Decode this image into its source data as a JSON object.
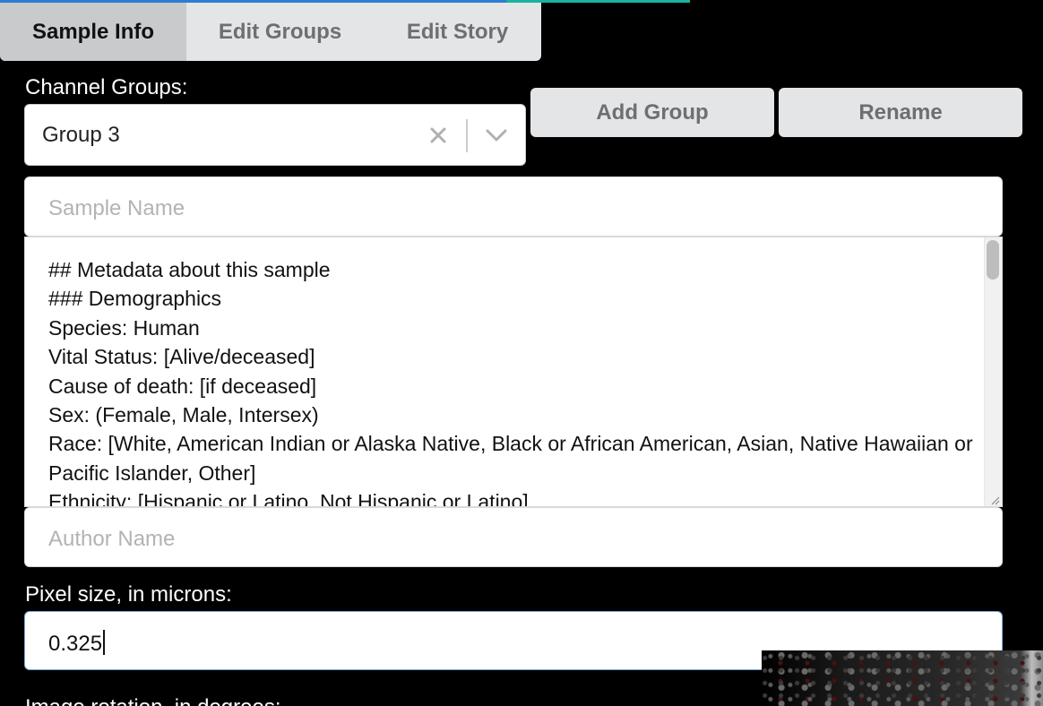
{
  "tabs": [
    {
      "label": "Sample Info",
      "active": true
    },
    {
      "label": "Edit Groups",
      "active": false
    },
    {
      "label": "Edit Story",
      "active": false
    }
  ],
  "channel_groups": {
    "label": "Channel Groups:",
    "selected": "Group 3",
    "clear_icon": "close-icon",
    "dropdown_icon": "chevron-down-icon"
  },
  "buttons": {
    "add_group": "Add Group",
    "rename": "Rename"
  },
  "sample_name": {
    "placeholder": "Sample Name",
    "value": ""
  },
  "description": {
    "lines": [
      "## Metadata about this sample",
      "### Demographics",
      "Species: Human",
      "Vital Status: [Alive/deceased]",
      "Cause of death: [if deceased]",
      "Sex: (Female, Male, Intersex)",
      "Race: [White, American Indian or Alaska Native, Black or African American, Asian, Native Hawaiian or Pacific Islander, Other]",
      "Ethnicity: [Hispanic or Latino, Not Hispanic or Latino]"
    ]
  },
  "author_name": {
    "placeholder": "Author Name",
    "value": ""
  },
  "pixel_size": {
    "label": "Pixel size, in microns:",
    "value": "0.325"
  },
  "rotation": {
    "label": "Image rotation, in degrees:"
  },
  "colors": {
    "progress_blue": "#2d7dd2",
    "progress_teal": "#19b3a0",
    "background": "#000000"
  }
}
